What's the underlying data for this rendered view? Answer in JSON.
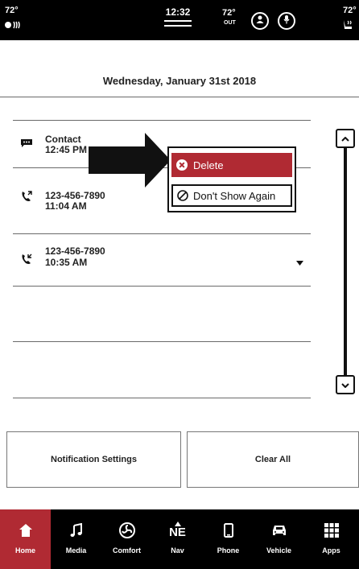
{
  "status": {
    "left_temp": "72°",
    "time": "12:32",
    "out_temp": "72°",
    "out_label": "OUT",
    "right_temp": "72°"
  },
  "date": "Wednesday, January 31st 2018",
  "notifications": [
    {
      "title": "Contact",
      "time": "12:45 PM",
      "icon": "message-icon"
    },
    {
      "title": "123-456-7890",
      "time": "11:04 AM",
      "icon": "outgoing-call-icon"
    },
    {
      "title": "123-456-7890",
      "time": "10:35 AM",
      "icon": "incoming-call-icon"
    }
  ],
  "menu": {
    "delete": "Delete",
    "dont_show": "Don't Show Again"
  },
  "buttons": {
    "settings": "Notification Settings",
    "clear": "Clear All"
  },
  "nav": {
    "compass": "NE",
    "items": [
      {
        "label": "Home"
      },
      {
        "label": "Media"
      },
      {
        "label": "Comfort"
      },
      {
        "label": "Nav"
      },
      {
        "label": "Phone"
      },
      {
        "label": "Vehicle"
      },
      {
        "label": "Apps"
      }
    ]
  },
  "colors": {
    "accent": "#b02a33",
    "background": "#ffffff",
    "bars": "#000000"
  }
}
